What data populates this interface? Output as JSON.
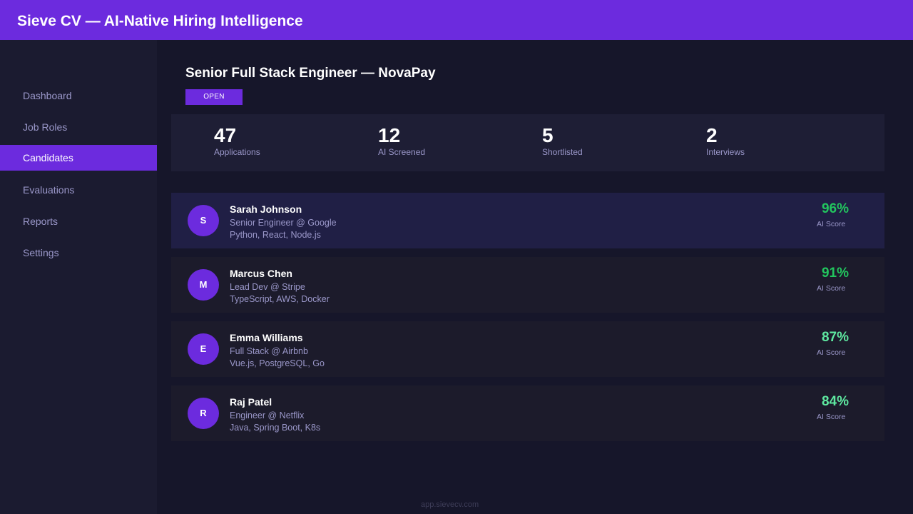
{
  "header": {
    "title": "Sieve CV — AI-Native Hiring Intelligence"
  },
  "sidebar": {
    "items": [
      {
        "label": "Dashboard",
        "active": false
      },
      {
        "label": "Job Roles",
        "active": false
      },
      {
        "label": "Candidates",
        "active": true
      },
      {
        "label": "Evaluations",
        "active": false
      },
      {
        "label": "Reports",
        "active": false
      },
      {
        "label": "Settings",
        "active": false
      }
    ]
  },
  "job": {
    "title": "Senior Full Stack Engineer — NovaPay",
    "status": "OPEN"
  },
  "stats": [
    {
      "value": "47",
      "label": "Applications"
    },
    {
      "value": "12",
      "label": "AI Screened"
    },
    {
      "value": "5",
      "label": "Shortlisted"
    },
    {
      "value": "2",
      "label": "Interviews"
    }
  ],
  "candidates": [
    {
      "initial": "S",
      "name": "Sarah Johnson",
      "role": "Senior Engineer @ Google",
      "skills": "Python, React, Node.js",
      "score": "96%",
      "score_label": "AI Score"
    },
    {
      "initial": "M",
      "name": "Marcus Chen",
      "role": "Lead Dev @ Stripe",
      "skills": "TypeScript, AWS, Docker",
      "score": "91%",
      "score_label": "AI Score"
    },
    {
      "initial": "E",
      "name": "Emma Williams",
      "role": "Full Stack @ Airbnb",
      "skills": "Vue.js, PostgreSQL, Go",
      "score": "87%",
      "score_label": "AI Score"
    },
    {
      "initial": "R",
      "name": "Raj Patel",
      "role": "Engineer @ Netflix",
      "skills": "Java, Spring Boot, K8s",
      "score": "84%",
      "score_label": "AI Score"
    }
  ],
  "colors": {
    "brand": "#6c2bde",
    "score_high": "#22c55e",
    "score_mid": "#5ee8a0"
  },
  "footer": {
    "url": "app.sievecv.com"
  }
}
